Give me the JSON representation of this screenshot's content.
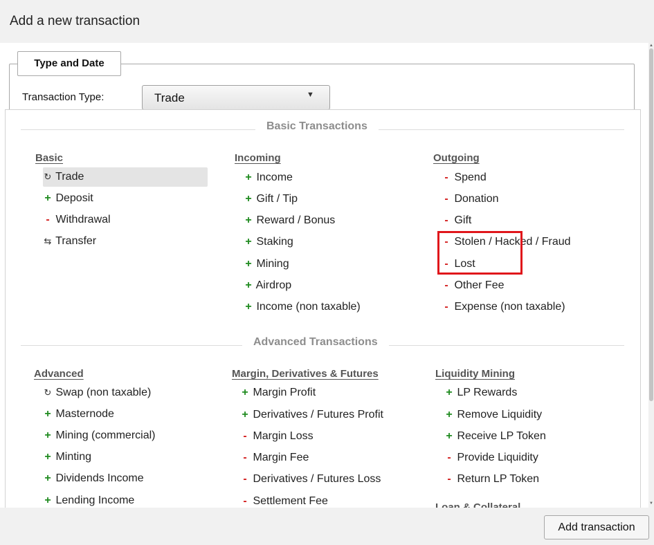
{
  "dialog": {
    "title": "Add a new transaction"
  },
  "tab": {
    "label": "Type and Date"
  },
  "transaction_type": {
    "label": "Transaction Type:",
    "selected": "Trade"
  },
  "sections": {
    "basic_title": "Basic Transactions",
    "advanced_title": "Advanced Transactions"
  },
  "basic_columns": [
    {
      "header": "Basic",
      "items": [
        {
          "sign": "↻",
          "label": "Trade"
        },
        {
          "sign": "+",
          "label": "Deposit"
        },
        {
          "sign": "-",
          "label": "Withdrawal"
        },
        {
          "sign": "⇆",
          "label": "Transfer"
        }
      ]
    },
    {
      "header": "Incoming",
      "items": [
        {
          "sign": "+",
          "label": "Income"
        },
        {
          "sign": "+",
          "label": "Gift / Tip"
        },
        {
          "sign": "+",
          "label": "Reward / Bonus"
        },
        {
          "sign": "+",
          "label": "Staking"
        },
        {
          "sign": "+",
          "label": "Mining"
        },
        {
          "sign": "+",
          "label": "Airdrop"
        },
        {
          "sign": "+",
          "label": "Income (non taxable)"
        }
      ]
    },
    {
      "header": "Outgoing",
      "items": [
        {
          "sign": "-",
          "label": "Spend"
        },
        {
          "sign": "-",
          "label": "Donation"
        },
        {
          "sign": "-",
          "label": "Gift"
        },
        {
          "sign": "-",
          "label": "Stolen / Hacked / Fraud"
        },
        {
          "sign": "-",
          "label": "Lost"
        },
        {
          "sign": "-",
          "label": "Other Fee"
        },
        {
          "sign": "-",
          "label": "Expense (non taxable)"
        }
      ]
    }
  ],
  "advanced_columns": [
    {
      "header": "Advanced",
      "items": [
        {
          "sign": "↻",
          "label": "Swap (non taxable)"
        },
        {
          "sign": "+",
          "label": "Masternode"
        },
        {
          "sign": "+",
          "label": "Mining (commercial)"
        },
        {
          "sign": "+",
          "label": "Minting"
        },
        {
          "sign": "+",
          "label": "Dividends Income"
        },
        {
          "sign": "+",
          "label": "Lending Income"
        }
      ]
    },
    {
      "header": "Margin, Derivatives & Futures",
      "items": [
        {
          "sign": "+",
          "label": "Margin Profit"
        },
        {
          "sign": "+",
          "label": "Derivatives / Futures Profit"
        },
        {
          "sign": "-",
          "label": "Margin Loss"
        },
        {
          "sign": "-",
          "label": "Margin Fee"
        },
        {
          "sign": "-",
          "label": "Derivatives / Futures Loss"
        },
        {
          "sign": "-",
          "label": "Settlement Fee"
        }
      ]
    },
    {
      "header": "Liquidity Mining",
      "items": [
        {
          "sign": "+",
          "label": "LP Rewards"
        },
        {
          "sign": "+",
          "label": "Remove Liquidity"
        },
        {
          "sign": "+",
          "label": "Receive LP Token"
        },
        {
          "sign": "-",
          "label": "Provide Liquidity"
        },
        {
          "sign": "-",
          "label": "Return LP Token"
        }
      ],
      "next_header": "Loan & Collateral"
    }
  ],
  "footer": {
    "add_button": "Add transaction"
  },
  "colors": {
    "plus": "#1e8a1e",
    "minus": "#d42020",
    "highlight": "#e0161b",
    "selected_bg": "#e4e4e4"
  }
}
